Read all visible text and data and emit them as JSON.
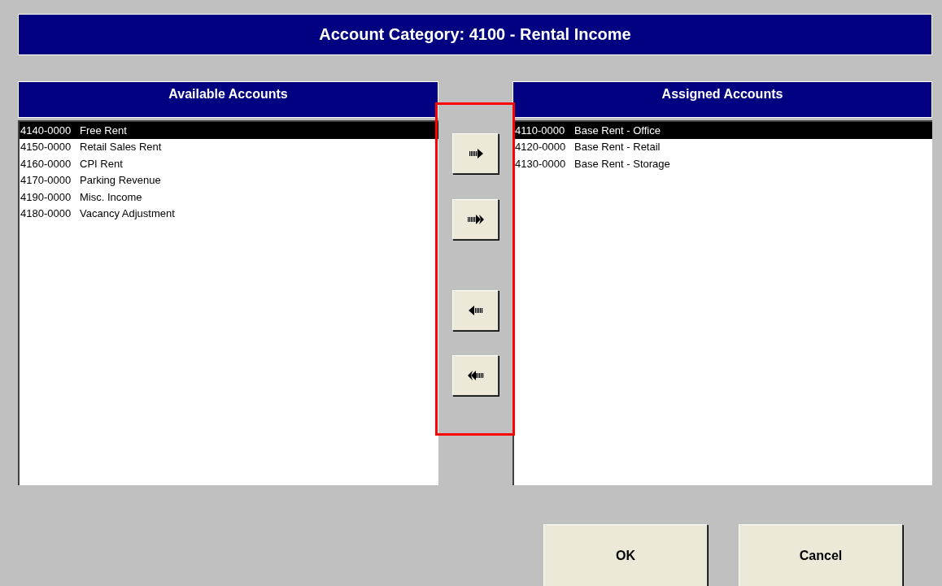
{
  "window": {
    "title": "Account Category: 4100 - Rental Income"
  },
  "available": {
    "heading": "Available Accounts",
    "rows": [
      {
        "code": "4140-0000",
        "name": "Free Rent",
        "selected": true
      },
      {
        "code": "4150-0000",
        "name": "Retail Sales Rent",
        "selected": false
      },
      {
        "code": "4160-0000",
        "name": "CPI Rent",
        "selected": false
      },
      {
        "code": "4170-0000",
        "name": "Parking Revenue",
        "selected": false
      },
      {
        "code": "4190-0000",
        "name": "Misc. Income",
        "selected": false
      },
      {
        "code": "4180-0000",
        "name": "Vacancy Adjustment",
        "selected": false
      }
    ]
  },
  "transfer_buttons": [
    {
      "kind": "move-one-right"
    },
    {
      "kind": "move-all-right"
    },
    {
      "kind": "move-one-left"
    },
    {
      "kind": "move-all-left"
    }
  ],
  "assigned": {
    "heading": "Assigned Accounts",
    "rows": [
      {
        "code": "4110-0000",
        "name": "Base Rent - Office",
        "selected": true
      },
      {
        "code": "4120-0000",
        "name": "Base Rent - Retail",
        "selected": false
      },
      {
        "code": "4130-0000",
        "name": "Base Rent - Storage",
        "selected": false
      }
    ]
  },
  "buttons": [
    {
      "label": "OK"
    },
    {
      "label": "Cancel"
    }
  ]
}
